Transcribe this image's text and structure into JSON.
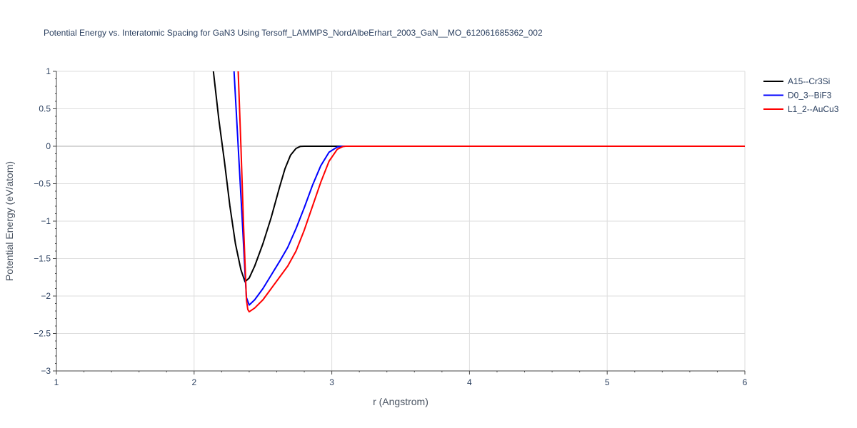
{
  "chart_data": {
    "type": "line",
    "title": "Potential Energy vs. Interatomic Spacing for GaN3 Using Tersoff_LAMMPS_NordAlbeErhart_2003_GaN__MO_612061685362_002",
    "xlabel": "r (Angstrom)",
    "ylabel": "Potential Energy (eV/atom)",
    "xlim": [
      1,
      6
    ],
    "ylim": [
      -3,
      1
    ],
    "xticks": [
      1,
      2,
      3,
      4,
      5,
      6
    ],
    "xtick_labels": [
      "1",
      "2",
      "3",
      "4",
      "5",
      "6"
    ],
    "yticks": [
      1,
      0.5,
      0,
      -0.5,
      -1,
      -1.5,
      -2,
      -2.5,
      -3
    ],
    "ytick_labels": [
      "1",
      "0.5",
      "0",
      "−0.5",
      "−1",
      "−1.5",
      "−2",
      "−2.5",
      "−3"
    ],
    "grid": true,
    "legend_position": "top-right, outside plot",
    "series": [
      {
        "name": "A15--Cr3Si",
        "color": "#000000",
        "x": [
          2.14,
          2.18,
          2.22,
          2.26,
          2.3,
          2.34,
          2.37,
          2.4,
          2.44,
          2.5,
          2.56,
          2.62,
          2.66,
          2.7,
          2.74,
          2.77,
          2.8,
          2.9,
          3.0,
          3.2,
          4.0,
          5.0,
          6.0
        ],
        "y": [
          1.0,
          0.35,
          -0.2,
          -0.8,
          -1.3,
          -1.65,
          -1.81,
          -1.76,
          -1.6,
          -1.3,
          -0.95,
          -0.55,
          -0.3,
          -0.12,
          -0.03,
          -0.003,
          0.0,
          0.0,
          0.0,
          0.0,
          0.0,
          0.0,
          0.0
        ]
      },
      {
        "name": "D0_3--BiF3",
        "color": "#0000ff",
        "x": [
          2.29,
          2.32,
          2.35,
          2.37,
          2.38,
          2.4,
          2.44,
          2.5,
          2.56,
          2.62,
          2.68,
          2.74,
          2.8,
          2.86,
          2.92,
          2.98,
          3.04,
          3.08,
          3.1,
          3.5,
          4.0,
          5.0,
          6.0
        ],
        "y": [
          1.0,
          0.0,
          -1.0,
          -1.7,
          -2.02,
          -2.12,
          -2.05,
          -1.9,
          -1.72,
          -1.54,
          -1.35,
          -1.1,
          -0.82,
          -0.52,
          -0.26,
          -0.08,
          -0.01,
          0.0,
          0.0,
          0.0,
          0.0,
          0.0,
          0.0
        ]
      },
      {
        "name": "L1_2--AuCu3",
        "color": "#ff0000",
        "x": [
          2.32,
          2.34,
          2.36,
          2.38,
          2.39,
          2.4,
          2.44,
          2.5,
          2.56,
          2.62,
          2.68,
          2.74,
          2.8,
          2.86,
          2.92,
          2.98,
          3.04,
          3.08,
          3.1,
          3.5,
          4.0,
          5.0,
          6.0
        ],
        "y": [
          1.0,
          0.0,
          -1.1,
          -2.05,
          -2.18,
          -2.21,
          -2.16,
          -2.05,
          -1.9,
          -1.75,
          -1.6,
          -1.4,
          -1.12,
          -0.8,
          -0.48,
          -0.2,
          -0.04,
          -0.005,
          0.0,
          0.0,
          0.0,
          0.0,
          0.0
        ]
      }
    ]
  }
}
